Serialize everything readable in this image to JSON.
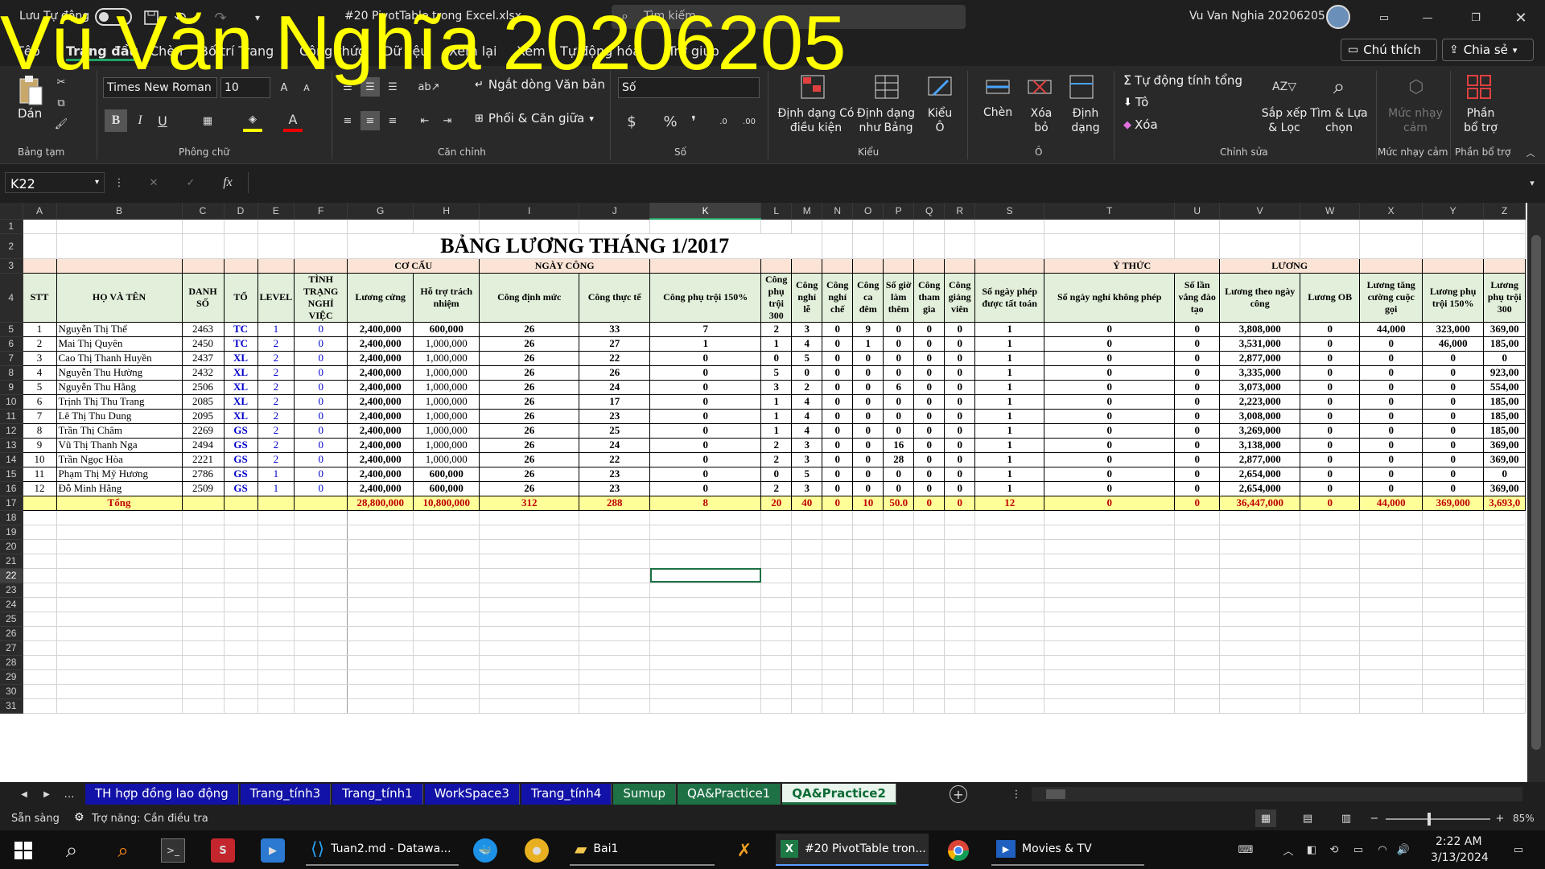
{
  "titlebar": {
    "autosave": "Lưu Tự động",
    "filename": "#20 PivotTable trong Excel.xlsx",
    "search": "Tìm kiếm",
    "user": "Vu Van Nghia 20206205"
  },
  "watermark": "Vũ Văn Nghĩa 20206205",
  "tabs": [
    "Tệp",
    "Trang đầu",
    "Chèn",
    "Bố trí Trang",
    "Công thức",
    "Dữ liệu",
    "Xem lại",
    "Xem",
    "Tự động hóa",
    "Trợ giúp"
  ],
  "tab_buttons": {
    "comment": "Chú thích",
    "share": "Chia sẻ"
  },
  "ribbon": {
    "clipboard": {
      "paste": "Dán",
      "group": "Bảng tạm"
    },
    "font": {
      "name": "Times New Roman",
      "size": "10",
      "group": "Phông chữ"
    },
    "align": {
      "wrap": "Ngắt dòng Văn bản",
      "merge": "Phối & Căn giữa",
      "group": "Căn chỉnh"
    },
    "number": {
      "format": "Số",
      "group": "Số"
    },
    "styles": {
      "cond": "Định dạng Có điều kiện",
      "table": "Định dạng như Bảng",
      "cell": "Kiểu Ô",
      "group": "Kiểu"
    },
    "cells": {
      "insert": "Chèn",
      "delete": "Xóa bỏ",
      "format": "Định dạng",
      "group": "Ô"
    },
    "editing": {
      "autosum": "Tự động tính tổng",
      "fill": "Tô",
      "clear": "Xóa",
      "sort": "Sắp xếp & Lọc",
      "find": "Tìm & Lựa chọn",
      "group": "Chỉnh sửa"
    },
    "sensitivity": {
      "label": "Mức nhạy cảm",
      "group": "Mức nhạy cảm"
    },
    "analysis": {
      "label": "Phần bổ trợ",
      "group": "Phần bổ trợ"
    }
  },
  "formula": {
    "namebox": "K22",
    "fx": "fx"
  },
  "columns": [
    "A",
    "B",
    "C",
    "D",
    "E",
    "F",
    "G",
    "H",
    "I",
    "J",
    "K",
    "L",
    "M",
    "N",
    "O",
    "P",
    "Q",
    "R",
    "S",
    "T",
    "U",
    "V",
    "W",
    "X",
    "Y",
    "Z"
  ],
  "sheet": {
    "title": "BẢNG LƯƠNG THÁNG 1/2017",
    "groups": {
      "cocau": "CƠ CẤU",
      "ngaycong": "NGÀY CÔNG",
      "ythuc": "Ý THỨC",
      "luong": "LƯƠNG"
    },
    "headers": [
      "STT",
      "HỌ VÀ TÊN",
      "DANH SỐ",
      "TỔ",
      "LEVEL",
      "TÌNH TRẠNG NGHỈ VIỆC",
      "Lương cứng",
      "Hỗ trợ trách nhiệm",
      "Công định mức",
      "Công thực tế",
      "Công phụ trội 150%",
      "Công phụ trội 300",
      "Công nghỉ lễ",
      "Công nghỉ chế",
      "Công ca đêm",
      "Số giờ làm thêm",
      "Công tham gia",
      "Công giảng viên",
      "Số ngày phép được tất toán",
      "Số ngày nghỉ không phép",
      "Số lần vắng đào tạo",
      "Lương theo ngày công",
      "Lương OB",
      "Lương tăng cường cuộc gọi",
      "Lương phụ trội 150%",
      "Lương phụ trội 300"
    ],
    "rows": [
      [
        "1",
        "Nguyễn Thị Thể",
        "2463",
        "TC",
        "1",
        "0",
        "2,400,000",
        "600,000",
        "26",
        "33",
        "7",
        "2",
        "3",
        "0",
        "9",
        "0",
        "0",
        "0",
        "1",
        "0",
        "0",
        "3,808,000",
        "0",
        "44,000",
        "323,000",
        "369,00"
      ],
      [
        "2",
        "Mai Thị Quyên",
        "2450",
        "TC",
        "2",
        "0",
        "2,400,000",
        "1,000,000",
        "26",
        "27",
        "1",
        "1",
        "4",
        "0",
        "1",
        "0",
        "0",
        "0",
        "1",
        "0",
        "0",
        "3,531,000",
        "0",
        "0",
        "46,000",
        "185,00"
      ],
      [
        "3",
        "Cao Thị Thanh Huyền",
        "2437",
        "XL",
        "2",
        "0",
        "2,400,000",
        "1,000,000",
        "26",
        "22",
        "0",
        "0",
        "5",
        "0",
        "0",
        "0",
        "0",
        "0",
        "1",
        "0",
        "0",
        "2,877,000",
        "0",
        "0",
        "0",
        "0"
      ],
      [
        "4",
        "Nguyễn Thu Hường",
        "2432",
        "XL",
        "2",
        "0",
        "2,400,000",
        "1,000,000",
        "26",
        "26",
        "0",
        "5",
        "0",
        "0",
        "0",
        "0",
        "0",
        "0",
        "1",
        "0",
        "0",
        "3,335,000",
        "0",
        "0",
        "0",
        "923,00"
      ],
      [
        "5",
        "Nguyễn Thu Hằng",
        "2506",
        "XL",
        "2",
        "0",
        "2,400,000",
        "1,000,000",
        "26",
        "24",
        "0",
        "3",
        "2",
        "0",
        "0",
        "6",
        "0",
        "0",
        "1",
        "0",
        "0",
        "3,073,000",
        "0",
        "0",
        "0",
        "554,00"
      ],
      [
        "6",
        "Trịnh Thị Thu Trang",
        "2085",
        "XL",
        "2",
        "0",
        "2,400,000",
        "1,000,000",
        "26",
        "17",
        "0",
        "1",
        "4",
        "0",
        "0",
        "0",
        "0",
        "0",
        "1",
        "0",
        "0",
        "2,223,000",
        "0",
        "0",
        "0",
        "185,00"
      ],
      [
        "7",
        "Lê Thị Thu Dung",
        "2095",
        "XL",
        "2",
        "0",
        "2,400,000",
        "1,000,000",
        "26",
        "23",
        "0",
        "1",
        "4",
        "0",
        "0",
        "0",
        "0",
        "0",
        "1",
        "0",
        "0",
        "3,008,000",
        "0",
        "0",
        "0",
        "185,00"
      ],
      [
        "8",
        "Trần Thị Châm",
        "2269",
        "GS",
        "2",
        "0",
        "2,400,000",
        "1,000,000",
        "26",
        "25",
        "0",
        "1",
        "4",
        "0",
        "0",
        "0",
        "0",
        "0",
        "1",
        "0",
        "0",
        "3,269,000",
        "0",
        "0",
        "0",
        "185,00"
      ],
      [
        "9",
        "Vũ Thị Thanh Nga",
        "2494",
        "GS",
        "2",
        "0",
        "2,400,000",
        "1,000,000",
        "26",
        "24",
        "0",
        "2",
        "3",
        "0",
        "0",
        "16",
        "0",
        "0",
        "1",
        "0",
        "0",
        "3,138,000",
        "0",
        "0",
        "0",
        "369,00"
      ],
      [
        "10",
        "Trần Ngọc Hòa",
        "2221",
        "GS",
        "2",
        "0",
        "2,400,000",
        "1,000,000",
        "26",
        "22",
        "0",
        "2",
        "3",
        "0",
        "0",
        "28",
        "0",
        "0",
        "1",
        "0",
        "0",
        "2,877,000",
        "0",
        "0",
        "0",
        "369,00"
      ],
      [
        "11",
        "Phạm Thị Mỹ Hương",
        "2786",
        "GS",
        "1",
        "0",
        "2,400,000",
        "600,000",
        "26",
        "23",
        "0",
        "0",
        "5",
        "0",
        "0",
        "0",
        "0",
        "0",
        "1",
        "0",
        "0",
        "2,654,000",
        "0",
        "0",
        "0",
        "0"
      ],
      [
        "12",
        "Đỗ Minh Hằng",
        "2509",
        "GS",
        "1",
        "0",
        "2,400,000",
        "600,000",
        "26",
        "23",
        "0",
        "2",
        "3",
        "0",
        "0",
        "0",
        "0",
        "0",
        "1",
        "0",
        "0",
        "2,654,000",
        "0",
        "0",
        "0",
        "369,00"
      ]
    ],
    "total": [
      "",
      "Tổng",
      "",
      "",
      "",
      "",
      "28,800,000",
      "10,800,000",
      "312",
      "288",
      "8",
      "20",
      "40",
      "0",
      "10",
      "50.0",
      "0",
      "0",
      "12",
      "0",
      "0",
      "36,447,000",
      "0",
      "44,000",
      "369,000",
      "3,693,0"
    ]
  },
  "sheettabs": [
    "TH hợp đồng lao động",
    "Trang_tính3",
    "Trang_tính1",
    "WorkSpace3",
    "Trang_tính4",
    "Sumup",
    "QA&Practice1",
    "QA&Practice2"
  ],
  "status": {
    "ready": "Sẵn sàng",
    "accessibility": "Trợ năng: Cần điều tra",
    "zoom": "85%"
  },
  "taskbar": {
    "vscode": "Tuan2.md - Datawa...",
    "folder": "Bai1",
    "excel": "#20 PivotTable tron...",
    "movies": "Movies & TV",
    "time": "2:22 AM",
    "date": "3/13/2024"
  }
}
